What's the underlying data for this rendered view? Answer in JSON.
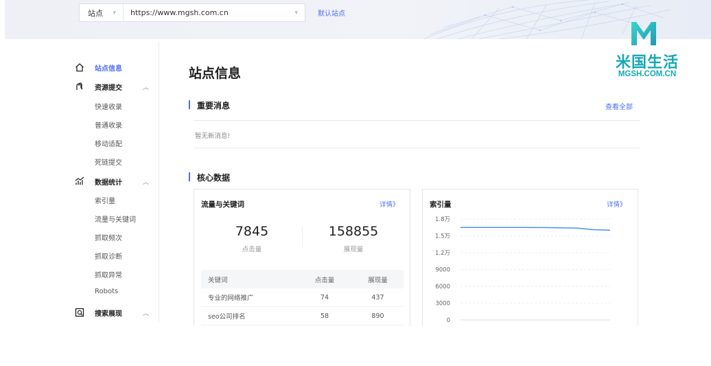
{
  "header": {
    "site_label": "站点",
    "site_url": "https://www.mgsh.com.cn",
    "default_site_link": "默认站点"
  },
  "watermark": {
    "cn_text": "米国生活",
    "en_text": "MGSH.COM.CN",
    "color": "#14a9b3"
  },
  "sidebar": {
    "site_info": "站点信息",
    "groups": [
      {
        "label": "资源提交",
        "icon": "submit-icon",
        "items": [
          "快速收录",
          "普通收录",
          "移动适配",
          "死链提交"
        ]
      },
      {
        "label": "数据统计",
        "icon": "stats-icon",
        "items": [
          "索引量",
          "流量与关键词",
          "抓取频次",
          "抓取诊断",
          "抓取异常",
          "Robots"
        ]
      },
      {
        "label": "搜索展现",
        "icon": "search-display-icon",
        "items": []
      }
    ]
  },
  "main": {
    "page_title": "站点信息",
    "news": {
      "title": "重要消息",
      "view_all": "查看全部",
      "empty": "暂无新消息!"
    },
    "core": {
      "title": "核心数据",
      "traffic": {
        "title": "流量与关键词",
        "detail_link": "详情》",
        "clicks_value": "7845",
        "clicks_label": "点击量",
        "impressions_value": "158855",
        "impressions_label": "展现量",
        "table_headers": [
          "关键词",
          "点击量",
          "展现量"
        ],
        "rows": [
          [
            "专业的网络推广",
            "74",
            "437"
          ],
          [
            "seo公司排名",
            "58",
            "890"
          ]
        ]
      },
      "index": {
        "title": "索引量",
        "detail_link": "详情》"
      }
    }
  },
  "chart_data": {
    "type": "line",
    "y_tick_labels": [
      "0",
      "3000",
      "6000",
      "9000",
      "1.2万",
      "1.5万",
      "1.8万"
    ],
    "y_ticks": [
      0,
      3000,
      6000,
      9000,
      12000,
      15000,
      18000
    ],
    "ylim": [
      0,
      18000
    ],
    "series": [
      {
        "values": [
          16500,
          16500,
          16500,
          16500,
          16500,
          16480,
          16450,
          16400,
          16100,
          16000
        ],
        "color": "#4e8ee8"
      }
    ],
    "grid": true
  },
  "colors": {
    "accent": "#4e6ef2",
    "line": "#4e8ee8"
  }
}
